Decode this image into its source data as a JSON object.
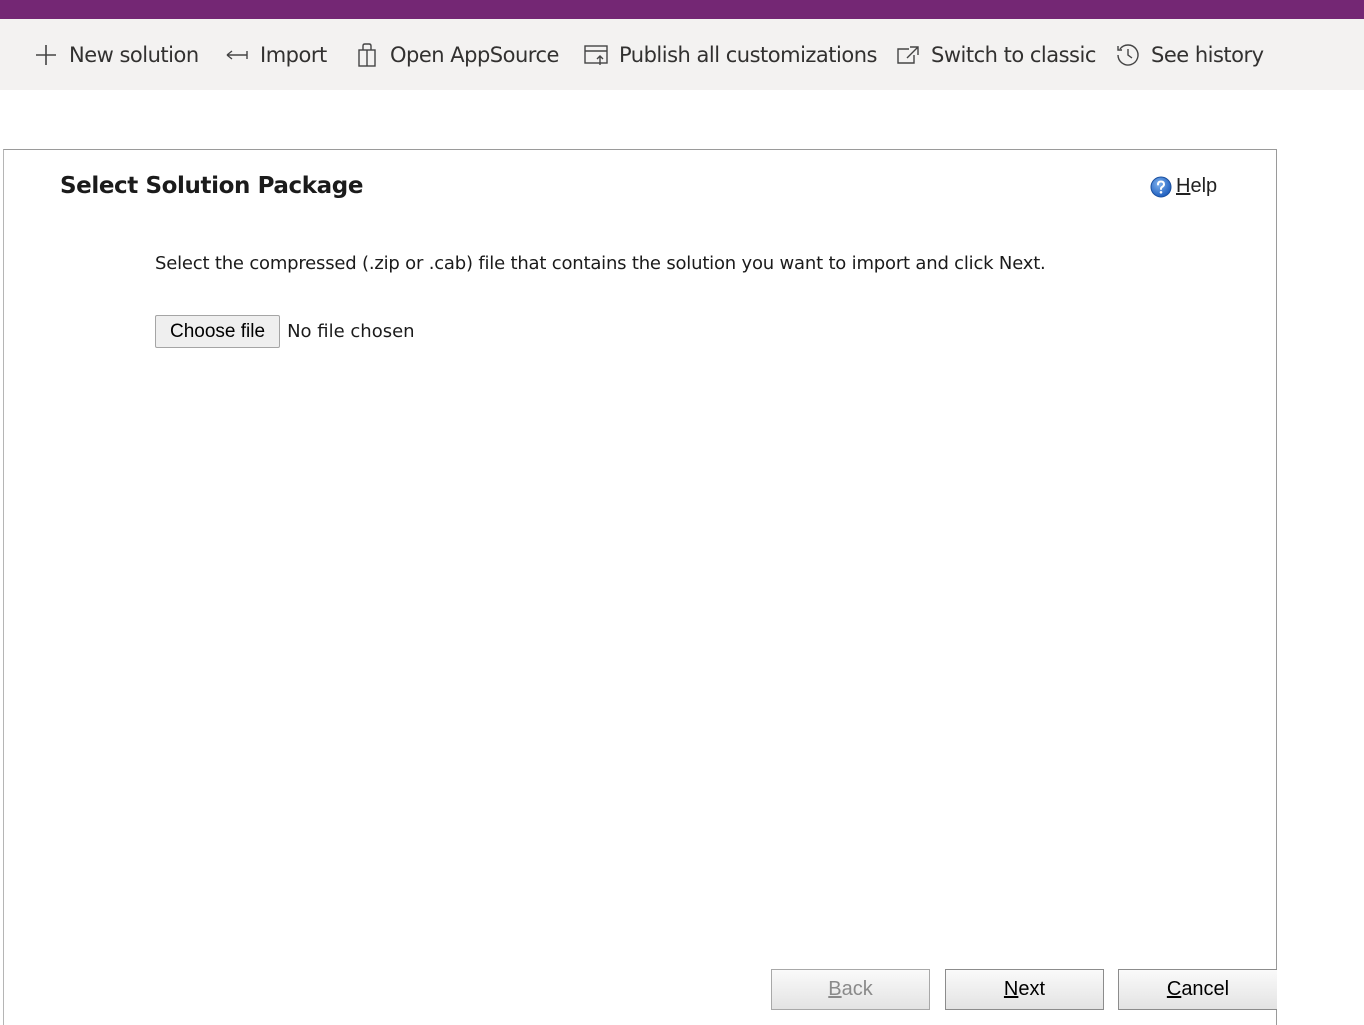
{
  "top_bar": {
    "color": "#742774"
  },
  "command_bar": {
    "background": "#f3f2f1",
    "items": [
      {
        "icon": "plus-icon",
        "label": "New solution"
      },
      {
        "icon": "import-icon",
        "label": "Import"
      },
      {
        "icon": "shopping-bag-icon",
        "label": "Open AppSource"
      },
      {
        "icon": "publish-icon",
        "label": "Publish all customizations"
      },
      {
        "icon": "external-link-icon",
        "label": "Switch to classic"
      },
      {
        "icon": "history-icon",
        "label": "See history"
      }
    ]
  },
  "dialog": {
    "title": "Select Solution Package",
    "help": {
      "icon": "help-icon",
      "accesskey_letter": "H",
      "rest": "elp"
    },
    "instructions": "Select the compressed (.zip or .cab) file that contains the solution you want to import and click Next.",
    "file_input": {
      "button_label": "Choose file",
      "status": "No file chosen"
    },
    "buttons": {
      "back": {
        "accesskey_letter": "B",
        "rest": "ack",
        "disabled": true
      },
      "next": {
        "accesskey_letter": "N",
        "rest": "ext"
      },
      "cancel": {
        "accesskey_letter": "C",
        "rest": "ancel"
      }
    }
  }
}
